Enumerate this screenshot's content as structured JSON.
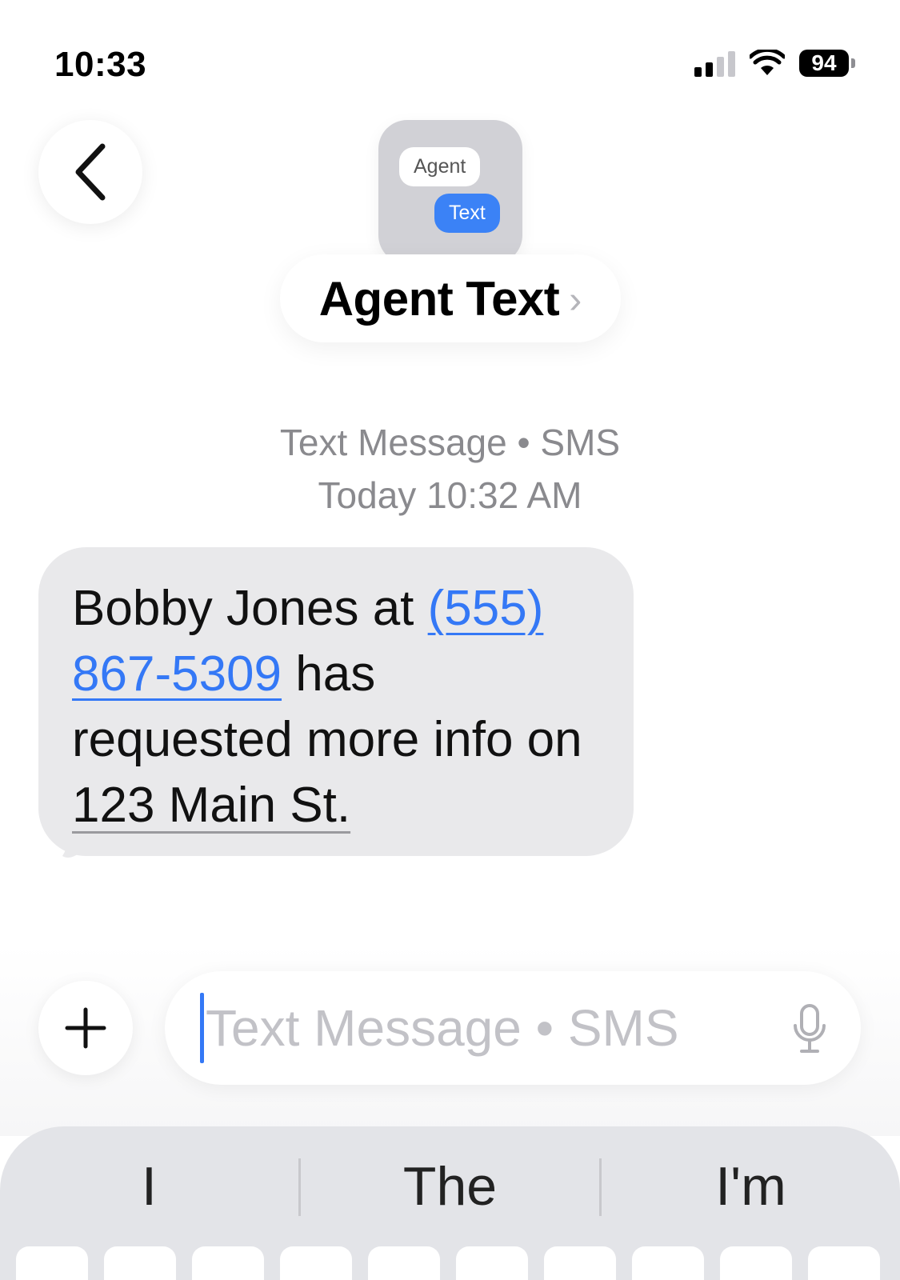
{
  "status_bar": {
    "time": "10:33",
    "battery_level": "94",
    "signal_bars_active": 2,
    "signal_bars_total": 4
  },
  "header": {
    "back_icon": "chevron-left-icon",
    "avatar": {
      "bubble_top": "Agent",
      "bubble_bottom": "Text"
    },
    "contact_name": "Agent Text",
    "disclosure_glyph": "›"
  },
  "thread": {
    "service_line": "Text Message • SMS",
    "timestamp": "Today 10:32 AM",
    "message": {
      "before_phone": "Bobby Jones at ",
      "phone": "(555) 867-5309",
      "after_phone": " has requested more info on ",
      "address": "123 Main St."
    }
  },
  "composer": {
    "plus_icon": "plus-icon",
    "placeholder": "Text Message • SMS",
    "mic_icon": "microphone-icon"
  },
  "keyboard": {
    "suggestions": [
      "I",
      "The",
      "I'm"
    ]
  },
  "colors": {
    "accent": "#3478f6",
    "bubble_received": "#e9e9eb",
    "meta_text": "#8a8a8e",
    "keyboard_bg": "#e3e4e8"
  }
}
